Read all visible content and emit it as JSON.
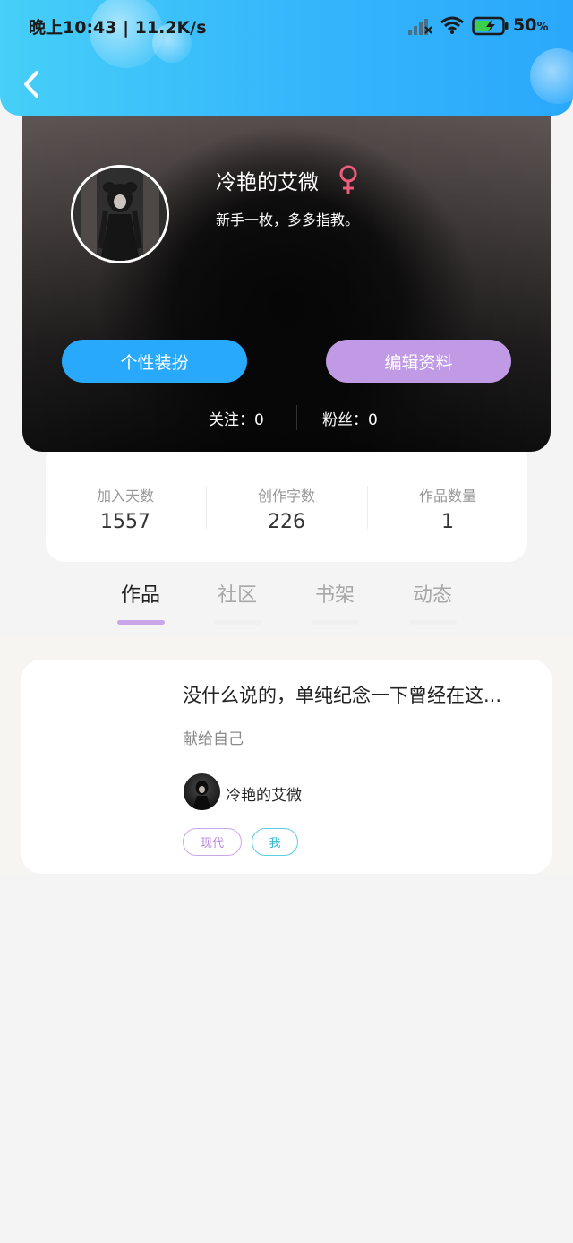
{
  "status_bar": {
    "time_speed": "晚上10:43 | 11.2K/s",
    "battery_percent": "50",
    "battery_unit": "%"
  },
  "profile": {
    "username": "冷艳的艾微",
    "bio": "新手一枚，多多指教。",
    "gender_icon": "female-symbol-icon",
    "gender_color": "#ef5b7a",
    "buttons": {
      "dressup": "个性装扮",
      "edit": "编辑资料"
    },
    "following": "关注：0",
    "fans": "粉丝：0"
  },
  "stats": [
    {
      "label": "加入天数",
      "value": "1557"
    },
    {
      "label": "创作字数",
      "value": "226"
    },
    {
      "label": "作品数量",
      "value": "1"
    }
  ],
  "tabs": [
    {
      "label": "作品",
      "active": true
    },
    {
      "label": "社区",
      "active": false
    },
    {
      "label": "书架",
      "active": false
    },
    {
      "label": "动态",
      "active": false
    }
  ],
  "works": [
    {
      "title": "没什么说的，单纯纪念一下曾经在这...",
      "subtitle": "献给自己",
      "author": "冷艳的艾微",
      "tags": [
        "现代",
        "我"
      ]
    }
  ],
  "colors": {
    "header_accent": "#36b7fb",
    "dressup_button": "#28a9fb",
    "edit_button": "#c19ae6",
    "active_tab_underline": "#c9a6ea"
  }
}
